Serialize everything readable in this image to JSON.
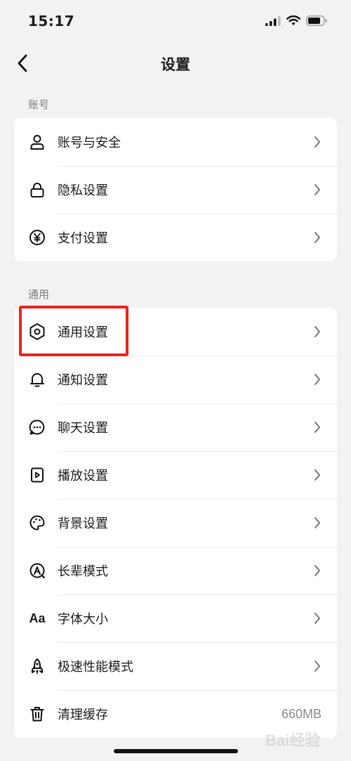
{
  "status_bar": {
    "time": "15:17"
  },
  "nav": {
    "title": "设置"
  },
  "sections": {
    "account": {
      "label": "账号",
      "items": [
        {
          "label": "账号与安全",
          "icon": "person-icon"
        },
        {
          "label": "隐私设置",
          "icon": "lock-icon"
        },
        {
          "label": "支付设置",
          "icon": "yen-icon"
        }
      ]
    },
    "general": {
      "label": "通用",
      "items": [
        {
          "label": "通用设置",
          "icon": "gear-icon"
        },
        {
          "label": "通知设置",
          "icon": "bell-icon"
        },
        {
          "label": "聊天设置",
          "icon": "chat-bubble-icon"
        },
        {
          "label": "播放设置",
          "icon": "play-file-icon"
        },
        {
          "label": "背景设置",
          "icon": "palette-icon"
        },
        {
          "label": "长辈模式",
          "icon": "elder-mode-icon"
        },
        {
          "label": "字体大小",
          "icon_text": "Aa",
          "icon": "font-size-icon"
        },
        {
          "label": "极速性能模式",
          "icon": "rocket-icon"
        },
        {
          "label": "清理缓存",
          "value": "660MB",
          "icon": "trash-icon"
        }
      ]
    }
  },
  "watermark": "Bai经验",
  "colors": {
    "highlight": "#e8241e",
    "background": "#f2f2f2",
    "card": "#ffffff"
  }
}
